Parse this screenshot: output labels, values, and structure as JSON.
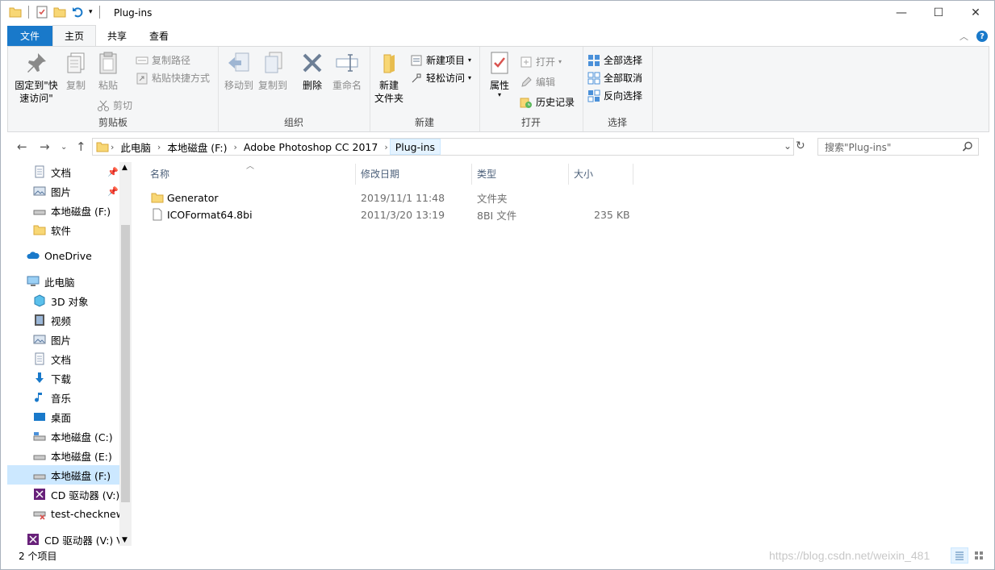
{
  "window": {
    "title": "Plug-ins"
  },
  "tabs": [
    {
      "label": "文件"
    },
    {
      "label": "主页"
    },
    {
      "label": "共享"
    },
    {
      "label": "查看"
    }
  ],
  "ribbon": {
    "clipboard": {
      "label": "剪贴板",
      "pin_quick": "固定到\"快\n速访问\"",
      "copy": "复制",
      "paste": "粘贴",
      "copy_path": "复制路径",
      "paste_shortcut": "粘贴快捷方式",
      "cut": "剪切"
    },
    "organize": {
      "label": "组织",
      "move_to": "移动到",
      "copy_to": "复制到",
      "delete": "删除",
      "rename": "重命名"
    },
    "new": {
      "label": "新建",
      "new_folder": "新建\n文件夹",
      "new_item": "新建项目",
      "easy_access": "轻松访问"
    },
    "open": {
      "label": "打开",
      "properties": "属性",
      "open": "打开",
      "edit": "编辑",
      "history": "历史记录"
    },
    "select": {
      "label": "选择",
      "select_all": "全部选择",
      "select_none": "全部取消",
      "invert": "反向选择"
    }
  },
  "address": {
    "crumbs": [
      "此电脑",
      "本地磁盘 (F:)",
      "Adobe Photoshop CC 2017",
      "Plug-ins"
    ],
    "search_placeholder": "搜索\"Plug-ins\""
  },
  "nav": {
    "quick": [
      {
        "label": "文档",
        "icon": "document-icon"
      },
      {
        "label": "图片",
        "icon": "pictures-icon"
      },
      {
        "label": "本地磁盘 (F:)",
        "icon": "drive-icon"
      },
      {
        "label": "软件",
        "icon": "folder-icon"
      }
    ],
    "onedrive": "OneDrive",
    "this_pc": "此电脑",
    "pc_items": [
      {
        "label": "3D 对象",
        "icon": "3d-objects-icon"
      },
      {
        "label": "视频",
        "icon": "videos-icon"
      },
      {
        "label": "图片",
        "icon": "pictures-icon"
      },
      {
        "label": "文档",
        "icon": "document-icon"
      },
      {
        "label": "下载",
        "icon": "download-icon"
      },
      {
        "label": "音乐",
        "icon": "music-icon"
      },
      {
        "label": "桌面",
        "icon": "desktop-icon"
      },
      {
        "label": "本地磁盘 (C:)",
        "icon": "drive-icon"
      },
      {
        "label": "本地磁盘 (E:)",
        "icon": "drive-icon"
      },
      {
        "label": "本地磁盘 (F:)",
        "icon": "drive-icon"
      },
      {
        "label": "CD 驱动器 (V:) V",
        "icon": "cd-drive-icon"
      },
      {
        "label": "test-checknew",
        "icon": "network-drive-icon"
      }
    ],
    "cd_drive": "CD 驱动器 (V:) Vi"
  },
  "columns": [
    "名称",
    "修改日期",
    "类型",
    "大小"
  ],
  "files": [
    {
      "name": "Generator",
      "date": "2019/11/1 11:48",
      "type": "文件夹",
      "size": "",
      "icon": "folder-icon"
    },
    {
      "name": "ICOFormat64.8bi",
      "date": "2011/3/20 13:19",
      "type": "8BI 文件",
      "size": "235 KB",
      "icon": "file-icon"
    }
  ],
  "status": {
    "count": "2 个项目"
  },
  "watermark": "https://blog.csdn.net/weixin_481"
}
